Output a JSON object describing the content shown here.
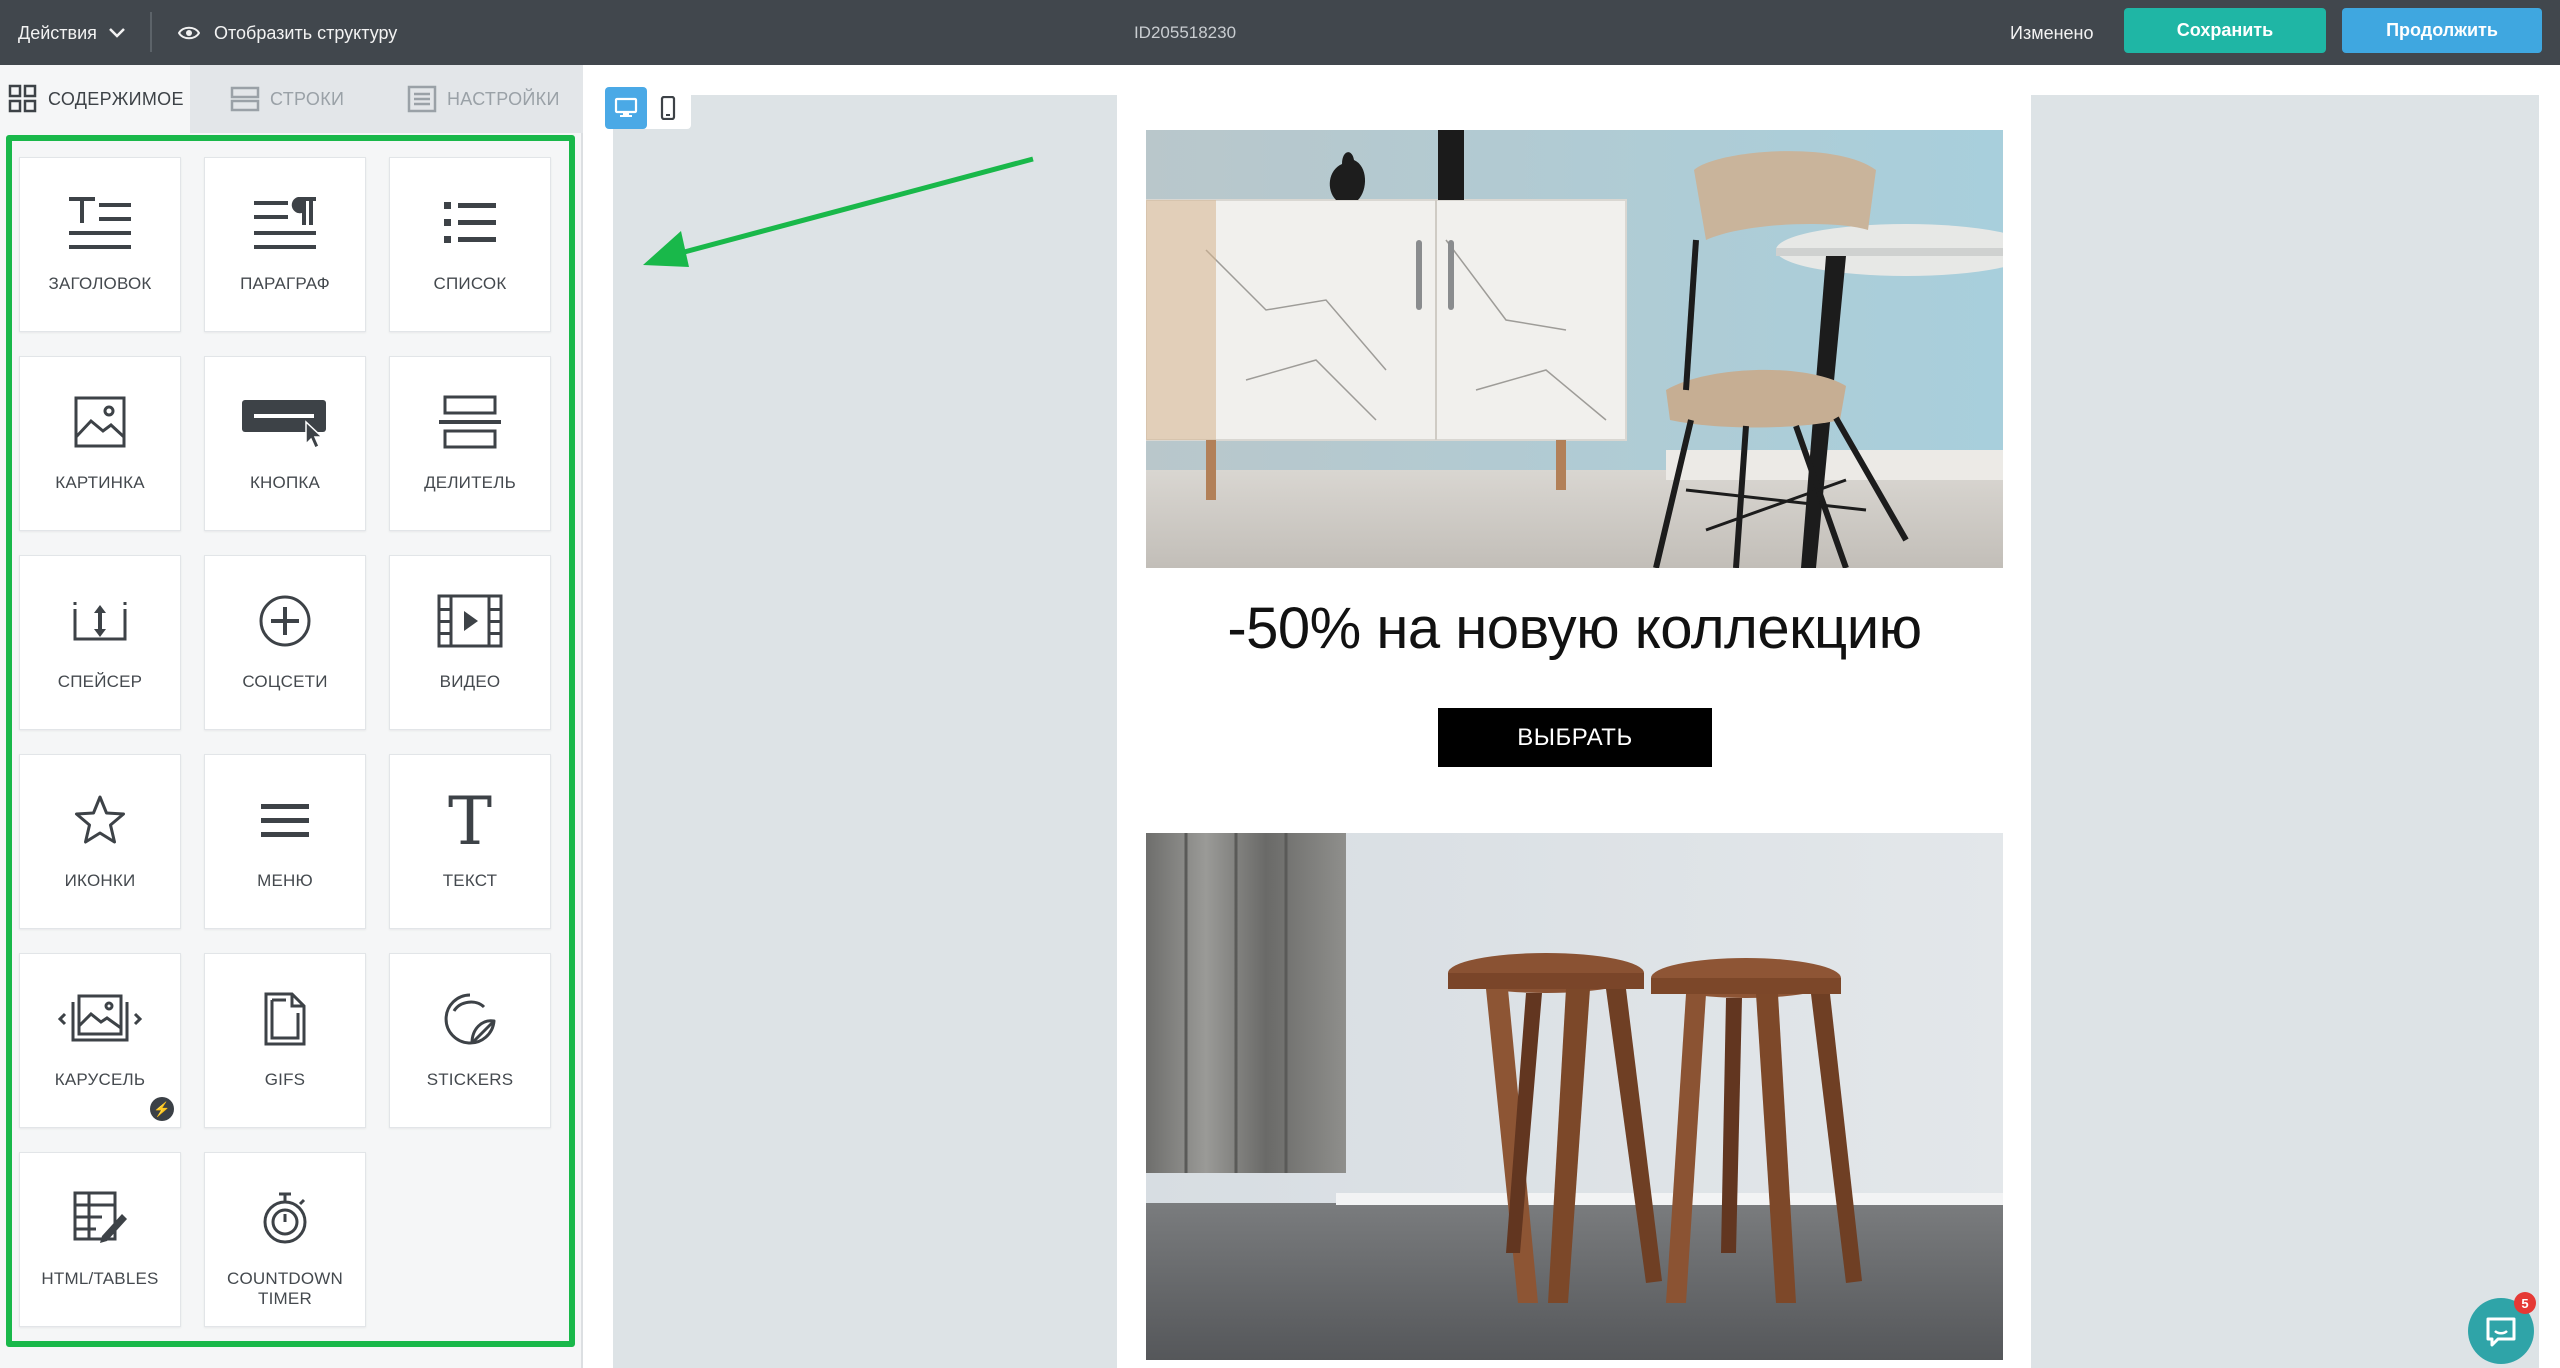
{
  "topbar": {
    "actions_label": "Действия",
    "structure_label": "Отобразить структуру",
    "doc_id": "ID205518230",
    "status": "Изменено",
    "save_label": "Сохранить",
    "continue_label": "Продолжить"
  },
  "panel": {
    "tabs": [
      {
        "label": "СОДЕРЖИМОЕ",
        "icon": "grid-icon"
      },
      {
        "label": "СТРОКИ",
        "icon": "rows-icon"
      },
      {
        "label": "НАСТРОЙКИ",
        "icon": "settings-list-icon"
      }
    ],
    "tiles": [
      {
        "label": "ЗАГОЛОВОК",
        "icon": "heading-icon"
      },
      {
        "label": "ПАРАГРАФ",
        "icon": "paragraph-icon"
      },
      {
        "label": "СПИСОК",
        "icon": "list-icon"
      },
      {
        "label": "КАРТИНКА",
        "icon": "image-icon"
      },
      {
        "label": "КНОПКА",
        "icon": "button-icon"
      },
      {
        "label": "ДЕЛИТЕЛЬ",
        "icon": "divider-icon"
      },
      {
        "label": "СПЕЙСЕР",
        "icon": "spacer-icon"
      },
      {
        "label": "СОЦСЕТИ",
        "icon": "social-icon"
      },
      {
        "label": "ВИДЕО",
        "icon": "video-icon"
      },
      {
        "label": "ИКОНКИ",
        "icon": "star-icon"
      },
      {
        "label": "МЕНЮ",
        "icon": "menu-icon"
      },
      {
        "label": "ТЕКСТ",
        "icon": "text-icon"
      },
      {
        "label": "КАРУСЕЛЬ",
        "icon": "carousel-icon"
      },
      {
        "label": "GIFS",
        "icon": "gif-file-icon"
      },
      {
        "label": "STICKERS",
        "icon": "sticker-icon"
      },
      {
        "label": "HTML/TABLES",
        "icon": "html-table-icon"
      },
      {
        "label": "COUNTDOWN TIMER",
        "icon": "stopwatch-icon"
      }
    ]
  },
  "email": {
    "headline": "-50% на новую коллекцию",
    "cta_label": "ВЫБРАТЬ"
  },
  "chat": {
    "unread": "5"
  },
  "colors": {
    "topbar": "#41474d",
    "save": "#1fb6a5",
    "continue": "#3fa7e0",
    "highlight_frame": "#19b84a",
    "canvas_bg": "#dde3e6"
  }
}
